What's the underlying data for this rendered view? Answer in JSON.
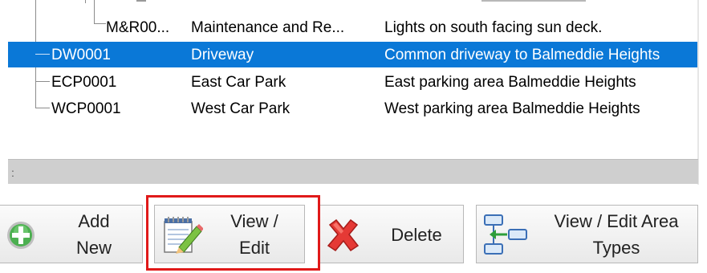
{
  "tree": {
    "rows": [
      {
        "code": "M&R00...",
        "name": "Maintenance and Re...",
        "description": "Lights on south facing sun deck.",
        "selected": false
      },
      {
        "code": "DW0001",
        "name": "Driveway",
        "description": "Common driveway to Balmeddie Heights",
        "selected": true
      },
      {
        "code": "ECP0001",
        "name": "East Car Park",
        "description": "East parking area Balmeddie Heights",
        "selected": false
      },
      {
        "code": "WCP0001",
        "name": "West Car Park",
        "description": "West parking area Balmeddie Heights",
        "selected": false
      }
    ]
  },
  "scrollbar": {
    "dots": ":"
  },
  "toolbar": {
    "add_new": {
      "line1": "Add",
      "line2": "New",
      "icon": "add-icon"
    },
    "view_edit": {
      "line1": "View /",
      "line2": "Edit",
      "icon": "notepad-pencil-icon"
    },
    "delete": {
      "line1": "Delete",
      "icon": "red-x-icon"
    },
    "view_edit_area_types": {
      "line1": "View / Edit Area",
      "line2": "Types",
      "icon": "hierarchy-icon"
    }
  },
  "colors": {
    "selection": "#0a78d7",
    "highlight": "#e01919",
    "add_green": "#4caf50",
    "delete_red": "#e53935"
  }
}
